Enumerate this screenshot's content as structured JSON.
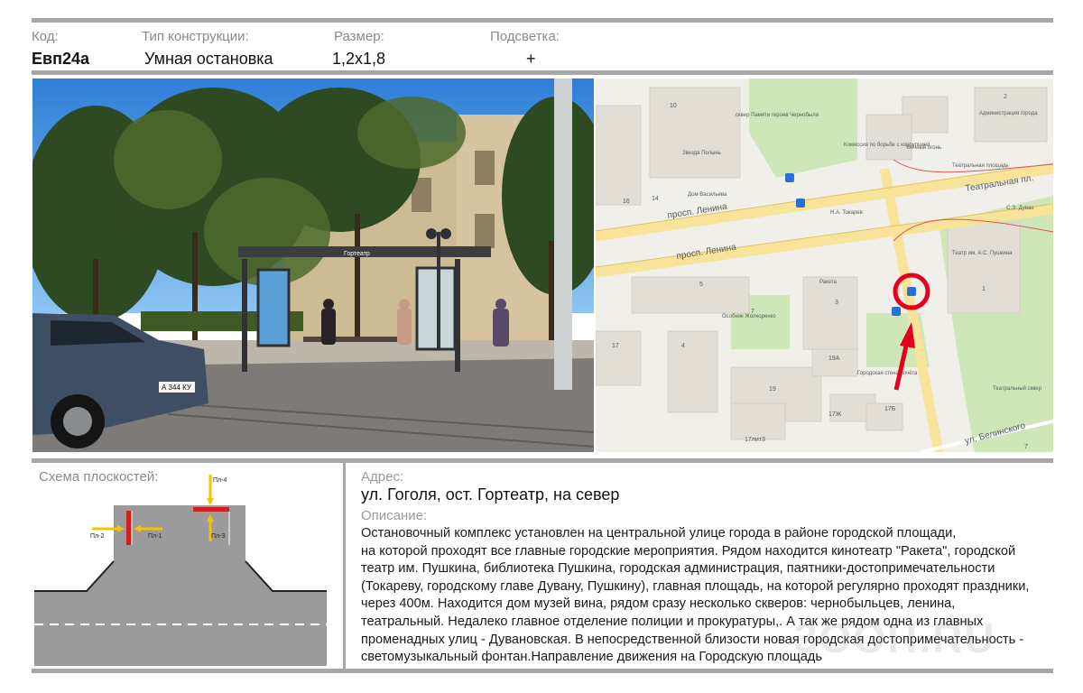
{
  "header": {
    "code_label": "Код:",
    "code_value": "Евп24а",
    "type_label": "Тип конструкции:",
    "type_value": "Умная остановка",
    "size_label": "Размер:",
    "size_value": "1,2х1,8",
    "light_label": "Подсветка:",
    "light_value": "+"
  },
  "photo": {
    "shelter_sign": "Гортеатр",
    "car_plate": "А 344 КУ"
  },
  "map": {
    "streets": [
      "просп. Ленина",
      "просп. Ленина",
      "Театральная пл.",
      "ул. Белинского"
    ],
    "places": {
      "memorial": "сквер Памяти героев Чернобыля",
      "zvezda": "Звезда Полынь",
      "dom_vasilyeva": "Дом Васильева",
      "committee": "Комиссия по борьбе с коррупцией",
      "eternal_flame": "Вечный огонь",
      "admin": "Администрация города",
      "theatre_square": "Театральная площадь",
      "tokarev": "Н.А. Токарев",
      "duvan": "С.Э. Дуван",
      "theatre": "Театр им. А.С. Пушкина",
      "raketa": "Ракета",
      "osobnyak": "Особняк Жолкоренко",
      "post_wall": "Городская стена почёта",
      "theatre_park": "Театральный сквер"
    },
    "numbers": [
      "10",
      "14",
      "16",
      "5",
      "3",
      "7",
      "17",
      "4",
      "19А",
      "19",
      "17Ж",
      "17Б",
      "17лит3",
      "1",
      "2",
      "7"
    ]
  },
  "schema": {
    "title": "Схема плоскостей:",
    "labels": [
      "Пл-1",
      "Пл-2",
      "Пл-3",
      "Пл-4"
    ]
  },
  "address": {
    "label": "Адрес:",
    "value": "ул. Гоголя, ост. Гортеатр, на север"
  },
  "description": {
    "label": "Описание:",
    "lines": [
      "Остановочный комплекс установлен на центральной улице города в районе городской площади,",
      "на которой проходят все главные городские мероприятия. Рядом находится кинотеатр \"Ракета\", городской",
      "театр им. Пушкина, библиотека Пушкина, городская администрация, паятники-достопримечательности",
      "(Токареву, городскому главе Дувану, Пушкину), главная площадь, на которой регулярно проходят праздники,",
      "через 400м. Находится дом музей вина, рядом сразу несколько скверов: чернобыльцев, ленина,",
      "театральный. Недалеко главное отделение полиции и прокуратуры,. А так же рядом одна из главных",
      "променадных улиц - Дувановская. В непосредственной близости новая городская достопримечательность -",
      "светомузыкальный фонтан.Направление движения на Городскую площадь"
    ]
  },
  "watermark": "3OOH.RU",
  "colors": {
    "bar": "#a7a7a7",
    "marker": "#e3001b",
    "asphalt": "#9b9b9b",
    "red_plane": "#d0201f",
    "yellow_arrow": "#f2c500"
  }
}
